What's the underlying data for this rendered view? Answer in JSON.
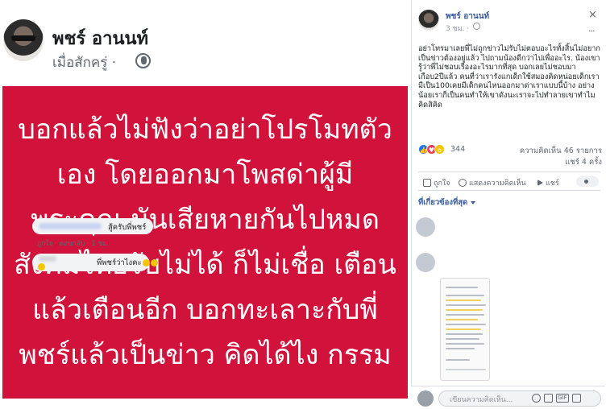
{
  "left_post": {
    "author": "พชร์ อานนท์",
    "time": "เมื่อสักครู่ ·",
    "image_text": [
      "บอกแล้วไม่ฟังว่าอย่าโปรโมทตัว",
      "เอง โดยออกมาโพสด่าผู้มี",
      "พระคุณ มันเสียหายกันไปหมด",
      "สังคมไทยรับไม่ได้ ก็ไม่เชื่อ เตือน",
      "แล้วเตือนอีก บอกทะเลาะกับพี่",
      "พชร์แล้วเป็นข่าว คิดได้ไง กรรม"
    ],
    "image_bg_color": "#d1123a"
  },
  "right_post": {
    "author": "พชร์ อานนท์",
    "time": "3 ชม. ·",
    "close": "×",
    "more": "···",
    "text": "อย่าโทรมาเลยพี่ไม่ถูกข่าวไม่รับไม่ตอบอะไรทั้งสิ้นไม่อยากเป็นข่าวต้องอยู่แล้ว ไปถามน้องดีกว่าไปเพื่ออะไร. น้องเขารู้ว่าพี่ไม่ชอบเรื่องอะไรมากที่สุด บอกเลยไม่ชอบมาเกือบ2ปีแล้ว คนที่ว่าเรารังแกเด็กใช้สมองคิดหน่อยเด็กเรามีเป็น100เคยมีเด็กคนไหนออกมาด่าเราแบบนี้บ้าง อย่างน้อยเราก็เป็นคนทำให้เขาดังนะเราจะไปทำลายเขาทำไม คิดสิคิด",
    "reaction_count": "344",
    "comment_count": "ความคิดเห็น 46 รายการ",
    "share_count": "แชร์ 4 ครั้ง",
    "actions": {
      "like": "ถูกใจ",
      "comment": "แสดงความคิดเห็น",
      "share": "แชร์"
    },
    "relevant_label": "ที่เกี่ยวข้องที่สุด",
    "comments": [
      {
        "text": "สู้ครับพี่พชร์",
        "meta": "ถูกใจ · ตอบกลับ · 1 ชม."
      },
      {
        "text": "พี่พชร์ว่าไงคะ"
      }
    ],
    "write_placeholder": "เขียนความคิดเห็น...",
    "gif_label": "GIF"
  },
  "colors": {
    "link": "#385898",
    "secondary_text": "#606770",
    "like_blue": "#1877f2",
    "love_red": "#f33e58",
    "wow_yellow": "#f7c400"
  }
}
